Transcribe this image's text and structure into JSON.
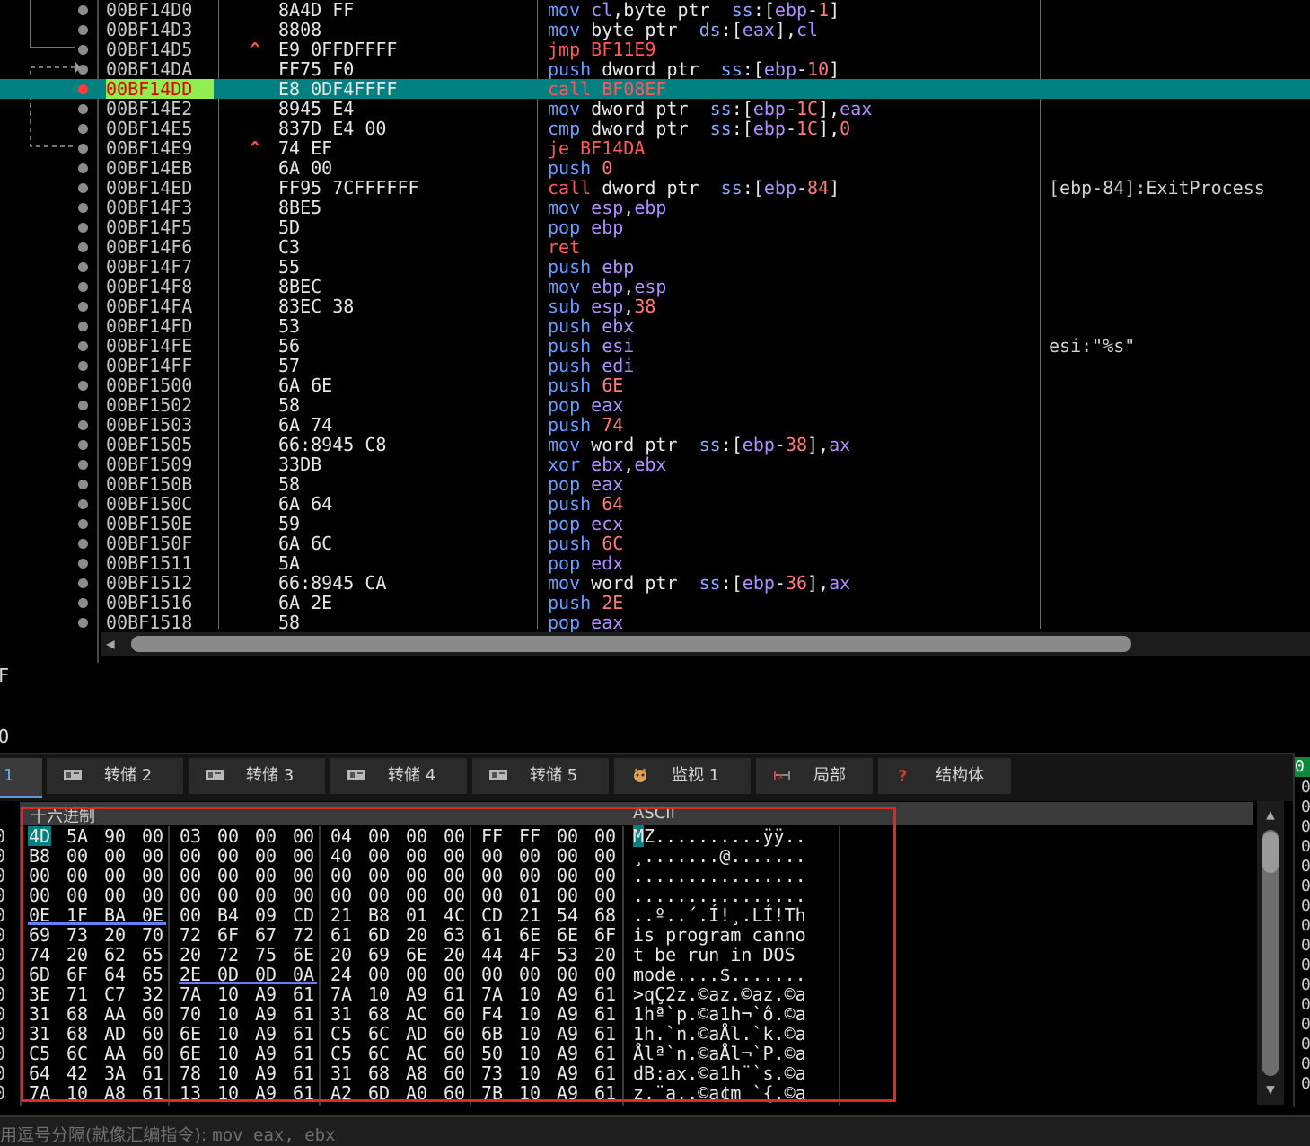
{
  "disasm": {
    "rows": [
      {
        "addr": "00BF14D0",
        "bytes": "8A4D FF",
        "jarrow": "",
        "ins": [
          [
            "kw",
            "mov "
          ],
          [
            "reg",
            "cl"
          ],
          [
            "txt",
            ",byte ptr  "
          ],
          [
            "seg",
            "ss"
          ],
          [
            "txt",
            ":["
          ],
          [
            "reg",
            "ebp"
          ],
          [
            "txt",
            "-"
          ],
          [
            "num",
            "1"
          ],
          [
            "txt",
            "]"
          ]
        ],
        "comment": ""
      },
      {
        "addr": "00BF14D3",
        "bytes": "8808",
        "jarrow": "",
        "ins": [
          [
            "kw",
            "mov "
          ],
          [
            "txt",
            "byte ptr  "
          ],
          [
            "seg",
            "ds"
          ],
          [
            "txt",
            ":["
          ],
          [
            "reg",
            "eax"
          ],
          [
            "txt",
            "],"
          ],
          [
            "reg",
            "cl"
          ]
        ],
        "comment": ""
      },
      {
        "addr": "00BF14D5",
        "bytes": "E9 0FFDFFFF",
        "jarrow": "^",
        "ins": [
          [
            "jmp",
            "jmp BF11E9"
          ]
        ],
        "comment": ""
      },
      {
        "addr": "00BF14DA",
        "bytes": "FF75 F0",
        "jarrow": "",
        "ins": [
          [
            "kw",
            "push "
          ],
          [
            "txt",
            "dword ptr  "
          ],
          [
            "seg",
            "ss"
          ],
          [
            "txt",
            ":["
          ],
          [
            "reg",
            "ebp"
          ],
          [
            "txt",
            "-"
          ],
          [
            "num",
            "10"
          ],
          [
            "txt",
            "]"
          ]
        ],
        "comment": ""
      },
      {
        "addr": "00BF14DD",
        "bytes": "E8 0DF4FFFF",
        "jarrow": "",
        "ins": [
          [
            "call",
            "call BF08EF"
          ]
        ],
        "comment": "",
        "selected": true
      },
      {
        "addr": "00BF14E2",
        "bytes": "8945 E4",
        "jarrow": "",
        "ins": [
          [
            "kw",
            "mov "
          ],
          [
            "txt",
            "dword ptr  "
          ],
          [
            "seg",
            "ss"
          ],
          [
            "txt",
            ":["
          ],
          [
            "reg",
            "ebp"
          ],
          [
            "txt",
            "-"
          ],
          [
            "num",
            "1C"
          ],
          [
            "txt",
            "],"
          ],
          [
            "reg",
            "eax"
          ]
        ],
        "comment": ""
      },
      {
        "addr": "00BF14E5",
        "bytes": "837D E4 00",
        "jarrow": "",
        "ins": [
          [
            "kw",
            "cmp "
          ],
          [
            "txt",
            "dword ptr  "
          ],
          [
            "seg",
            "ss"
          ],
          [
            "txt",
            ":["
          ],
          [
            "reg",
            "ebp"
          ],
          [
            "txt",
            "-"
          ],
          [
            "num",
            "1C"
          ],
          [
            "txt",
            "],"
          ],
          [
            "num",
            "0"
          ]
        ],
        "comment": ""
      },
      {
        "addr": "00BF14E9",
        "bytes": "74 EF",
        "jarrow": "^",
        "ins": [
          [
            "jmp",
            "je BF14DA"
          ]
        ],
        "comment": ""
      },
      {
        "addr": "00BF14EB",
        "bytes": "6A 00",
        "jarrow": "",
        "ins": [
          [
            "kw",
            "push "
          ],
          [
            "num",
            "0"
          ]
        ],
        "comment": ""
      },
      {
        "addr": "00BF14ED",
        "bytes": "FF95 7CFFFFFF",
        "jarrow": "",
        "ins": [
          [
            "call",
            "call "
          ],
          [
            "txt",
            "dword ptr  "
          ],
          [
            "seg",
            "ss"
          ],
          [
            "txt",
            ":["
          ],
          [
            "reg",
            "ebp"
          ],
          [
            "txt",
            "-"
          ],
          [
            "num",
            "84"
          ],
          [
            "txt",
            "]"
          ]
        ],
        "comment": "[ebp-84]:ExitProcess"
      },
      {
        "addr": "00BF14F3",
        "bytes": "8BE5",
        "jarrow": "",
        "ins": [
          [
            "kw",
            "mov "
          ],
          [
            "reg",
            "esp"
          ],
          [
            "txt",
            ","
          ],
          [
            "reg",
            "ebp"
          ]
        ],
        "comment": ""
      },
      {
        "addr": "00BF14F5",
        "bytes": "5D",
        "jarrow": "",
        "ins": [
          [
            "kw",
            "pop "
          ],
          [
            "reg",
            "ebp"
          ]
        ],
        "comment": ""
      },
      {
        "addr": "00BF14F6",
        "bytes": "C3",
        "jarrow": "",
        "ins": [
          [
            "call",
            "ret"
          ]
        ],
        "comment": ""
      },
      {
        "addr": "00BF14F7",
        "bytes": "55",
        "jarrow": "",
        "ins": [
          [
            "kw",
            "push "
          ],
          [
            "reg",
            "ebp"
          ]
        ],
        "comment": ""
      },
      {
        "addr": "00BF14F8",
        "bytes": "8BEC",
        "jarrow": "",
        "ins": [
          [
            "kw",
            "mov "
          ],
          [
            "reg",
            "ebp"
          ],
          [
            "txt",
            ","
          ],
          [
            "reg",
            "esp"
          ]
        ],
        "comment": ""
      },
      {
        "addr": "00BF14FA",
        "bytes": "83EC 38",
        "jarrow": "",
        "ins": [
          [
            "kw",
            "sub "
          ],
          [
            "reg",
            "esp"
          ],
          [
            "txt",
            ","
          ],
          [
            "num",
            "38"
          ]
        ],
        "comment": ""
      },
      {
        "addr": "00BF14FD",
        "bytes": "53",
        "jarrow": "",
        "ins": [
          [
            "kw",
            "push "
          ],
          [
            "reg",
            "ebx"
          ]
        ],
        "comment": ""
      },
      {
        "addr": "00BF14FE",
        "bytes": "56",
        "jarrow": "",
        "ins": [
          [
            "kw",
            "push "
          ],
          [
            "reg",
            "esi"
          ]
        ],
        "comment": "esi:\"%s\""
      },
      {
        "addr": "00BF14FF",
        "bytes": "57",
        "jarrow": "",
        "ins": [
          [
            "kw",
            "push "
          ],
          [
            "reg",
            "edi"
          ]
        ],
        "comment": ""
      },
      {
        "addr": "00BF1500",
        "bytes": "6A 6E",
        "jarrow": "",
        "ins": [
          [
            "kw",
            "push "
          ],
          [
            "num",
            "6E"
          ]
        ],
        "comment": ""
      },
      {
        "addr": "00BF1502",
        "bytes": "58",
        "jarrow": "",
        "ins": [
          [
            "kw",
            "pop "
          ],
          [
            "reg",
            "eax"
          ]
        ],
        "comment": ""
      },
      {
        "addr": "00BF1503",
        "bytes": "6A 74",
        "jarrow": "",
        "ins": [
          [
            "kw",
            "push "
          ],
          [
            "num",
            "74"
          ]
        ],
        "comment": ""
      },
      {
        "addr": "00BF1505",
        "bytes": "66:8945 C8",
        "jarrow": "",
        "ins": [
          [
            "kw",
            "mov "
          ],
          [
            "txt",
            "word ptr  "
          ],
          [
            "seg",
            "ss"
          ],
          [
            "txt",
            ":["
          ],
          [
            "reg",
            "ebp"
          ],
          [
            "txt",
            "-"
          ],
          [
            "num",
            "38"
          ],
          [
            "txt",
            "],"
          ],
          [
            "reg",
            "ax"
          ]
        ],
        "comment": ""
      },
      {
        "addr": "00BF1509",
        "bytes": "33DB",
        "jarrow": "",
        "ins": [
          [
            "kw",
            "xor "
          ],
          [
            "reg",
            "ebx"
          ],
          [
            "txt",
            ","
          ],
          [
            "reg",
            "ebx"
          ]
        ],
        "comment": ""
      },
      {
        "addr": "00BF150B",
        "bytes": "58",
        "jarrow": "",
        "ins": [
          [
            "kw",
            "pop "
          ],
          [
            "reg",
            "eax"
          ]
        ],
        "comment": ""
      },
      {
        "addr": "00BF150C",
        "bytes": "6A 64",
        "jarrow": "",
        "ins": [
          [
            "kw",
            "push "
          ],
          [
            "num",
            "64"
          ]
        ],
        "comment": ""
      },
      {
        "addr": "00BF150E",
        "bytes": "59",
        "jarrow": "",
        "ins": [
          [
            "kw",
            "pop "
          ],
          [
            "reg",
            "ecx"
          ]
        ],
        "comment": ""
      },
      {
        "addr": "00BF150F",
        "bytes": "6A 6C",
        "jarrow": "",
        "ins": [
          [
            "kw",
            "push "
          ],
          [
            "num",
            "6C"
          ]
        ],
        "comment": ""
      },
      {
        "addr": "00BF1511",
        "bytes": "5A",
        "jarrow": "",
        "ins": [
          [
            "kw",
            "pop "
          ],
          [
            "reg",
            "edx"
          ]
        ],
        "comment": ""
      },
      {
        "addr": "00BF1512",
        "bytes": "66:8945 CA",
        "jarrow": "",
        "ins": [
          [
            "kw",
            "mov "
          ],
          [
            "txt",
            "word ptr  "
          ],
          [
            "seg",
            "ss"
          ],
          [
            "txt",
            ":["
          ],
          [
            "reg",
            "ebp"
          ],
          [
            "txt",
            "-"
          ],
          [
            "num",
            "36"
          ],
          [
            "txt",
            "],"
          ],
          [
            "reg",
            "ax"
          ]
        ],
        "comment": ""
      },
      {
        "addr": "00BF1516",
        "bytes": "6A 2E",
        "jarrow": "",
        "ins": [
          [
            "kw",
            "push "
          ],
          [
            "num",
            "2E"
          ]
        ],
        "comment": ""
      },
      {
        "addr": "00BF1518",
        "bytes": "58",
        "jarrow": "",
        "ins": [
          [
            "kw",
            "pop "
          ],
          [
            "reg",
            "eax"
          ]
        ],
        "comment": ""
      }
    ]
  },
  "regfrag": {
    "line1": "F",
    "line2": "O"
  },
  "tabs": [
    {
      "label": "转储 2",
      "icon": "dump-icon"
    },
    {
      "label": "转储 3",
      "icon": "dump-icon"
    },
    {
      "label": "转储 4",
      "icon": "dump-icon"
    },
    {
      "label": "转储 5",
      "icon": "dump-icon"
    },
    {
      "label": "监视 1",
      "icon": "watch-icon"
    },
    {
      "label": "局部",
      "icon": "locals-icon"
    },
    {
      "label": "结构体",
      "icon": "struct-icon"
    }
  ],
  "active_tab": {
    "label": "1"
  },
  "dump": {
    "header_hex": "十六进制",
    "header_ascii": "ASCII",
    "rows": [
      {
        "hex": [
          "4D",
          "5A",
          "90",
          "00",
          "03",
          "00",
          "00",
          "00",
          "04",
          "00",
          "00",
          "00",
          "FF",
          "FF",
          "00",
          "00"
        ],
        "ascii": "MZ..........ÿÿ.."
      },
      {
        "hex": [
          "B8",
          "00",
          "00",
          "00",
          "00",
          "00",
          "00",
          "00",
          "40",
          "00",
          "00",
          "00",
          "00",
          "00",
          "00",
          "00"
        ],
        "ascii": "¸.......@......."
      },
      {
        "hex": [
          "00",
          "00",
          "00",
          "00",
          "00",
          "00",
          "00",
          "00",
          "00",
          "00",
          "00",
          "00",
          "00",
          "00",
          "00",
          "00"
        ],
        "ascii": "................"
      },
      {
        "hex": [
          "00",
          "00",
          "00",
          "00",
          "00",
          "00",
          "00",
          "00",
          "00",
          "00",
          "00",
          "00",
          "00",
          "01",
          "00",
          "00"
        ],
        "ascii": "................"
      },
      {
        "hex": [
          "0E",
          "1F",
          "BA",
          "0E",
          "00",
          "B4",
          "09",
          "CD",
          "21",
          "B8",
          "01",
          "4C",
          "CD",
          "21",
          "54",
          "68"
        ],
        "ascii": "..º..´.Í!¸.LÍ!Th"
      },
      {
        "hex": [
          "69",
          "73",
          "20",
          "70",
          "72",
          "6F",
          "67",
          "72",
          "61",
          "6D",
          "20",
          "63",
          "61",
          "6E",
          "6E",
          "6F"
        ],
        "ascii": "is program canno"
      },
      {
        "hex": [
          "74",
          "20",
          "62",
          "65",
          "20",
          "72",
          "75",
          "6E",
          "20",
          "69",
          "6E",
          "20",
          "44",
          "4F",
          "53",
          "20"
        ],
        "ascii": "t be run in DOS "
      },
      {
        "hex": [
          "6D",
          "6F",
          "64",
          "65",
          "2E",
          "0D",
          "0D",
          "0A",
          "24",
          "00",
          "00",
          "00",
          "00",
          "00",
          "00",
          "00"
        ],
        "ascii": "mode....$......."
      },
      {
        "hex": [
          "3E",
          "71",
          "C7",
          "32",
          "7A",
          "10",
          "A9",
          "61",
          "7A",
          "10",
          "A9",
          "61",
          "7A",
          "10",
          "A9",
          "61"
        ],
        "ascii": ">qÇ2z.©az.©az.©a"
      },
      {
        "hex": [
          "31",
          "68",
          "AA",
          "60",
          "70",
          "10",
          "A9",
          "61",
          "31",
          "68",
          "AC",
          "60",
          "F4",
          "10",
          "A9",
          "61"
        ],
        "ascii": "1hª`p.©a1h¬`ô.©a"
      },
      {
        "hex": [
          "31",
          "68",
          "AD",
          "60",
          "6E",
          "10",
          "A9",
          "61",
          "C5",
          "6C",
          "AD",
          "60",
          "6B",
          "10",
          "A9",
          "61"
        ],
        "ascii": "1h.`n.©aÅl.`k.©a"
      },
      {
        "hex": [
          "C5",
          "6C",
          "AA",
          "60",
          "6E",
          "10",
          "A9",
          "61",
          "C5",
          "6C",
          "AC",
          "60",
          "50",
          "10",
          "A9",
          "61"
        ],
        "ascii": "Ålª`n.©aÅl¬`P.©a"
      },
      {
        "hex": [
          "64",
          "42",
          "3A",
          "61",
          "78",
          "10",
          "A9",
          "61",
          "31",
          "68",
          "A8",
          "60",
          "73",
          "10",
          "A9",
          "61"
        ],
        "ascii": "dB:ax.©a1h¨`s.©a"
      },
      {
        "hex": [
          "7A",
          "10",
          "A8",
          "61",
          "13",
          "10",
          "A9",
          "61",
          "A2",
          "6D",
          "A0",
          "60",
          "7B",
          "10",
          "A9",
          "61"
        ],
        "ascii": "z.¨a..©a¢m `{.©a"
      }
    ]
  },
  "right_panel": {
    "tab": "0",
    "values": [
      "0",
      "0",
      "0",
      "0",
      "0",
      "0",
      "0",
      "0",
      "0",
      "0",
      "0",
      "0",
      "0",
      "0",
      "0",
      "0"
    ]
  },
  "command": {
    "prompt": "用逗号分隔(就像汇编指令): ",
    "example": "mov eax, ebx"
  },
  "colors": {
    "selection": "#008080",
    "accent": "#90ee50",
    "redbox": "#e02828",
    "breakpoint": "#ff3b3b"
  }
}
